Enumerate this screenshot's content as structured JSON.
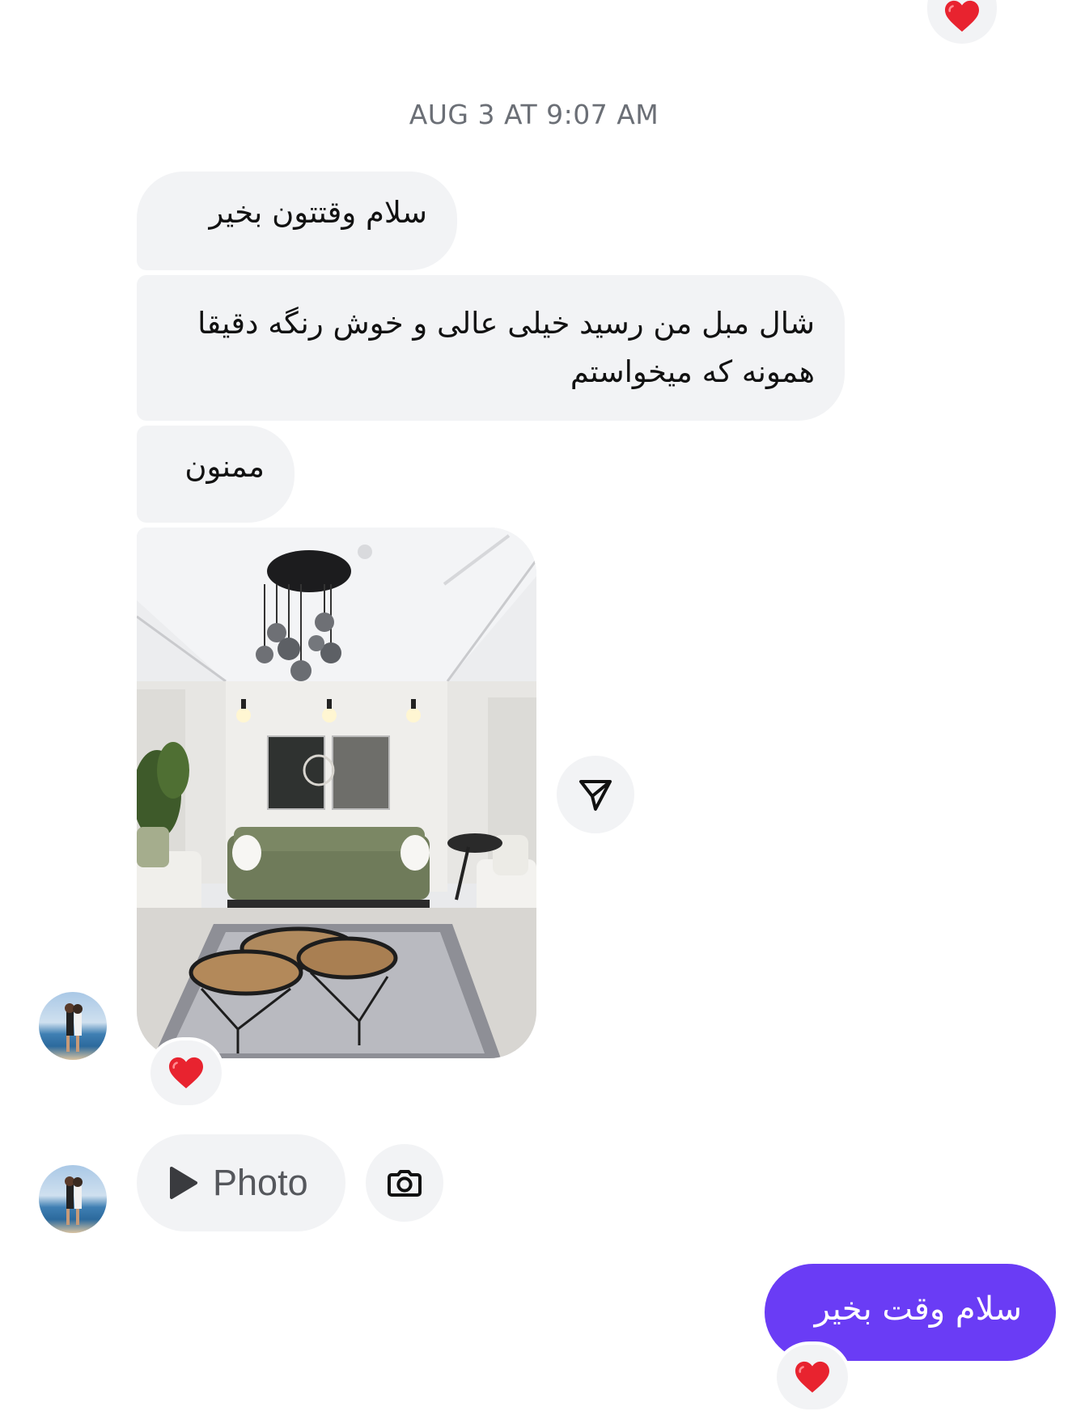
{
  "timestamp": "AUG 3 AT 9:07 AM",
  "incoming_messages": [
    {
      "text": "سلام وقتتون بخیر"
    },
    {
      "text": "شال مبل من رسید خیلی عالی و خوش رنگه دقیقا همونه که میخواستم"
    },
    {
      "text": "ممنون"
    }
  ],
  "photo_reply": {
    "label": "Photo"
  },
  "outgoing_message": {
    "text": "سلام وقت بخیر"
  },
  "colors": {
    "incoming_bubble": "#f2f3f5",
    "outgoing_bubble": "#6a3cf5",
    "reaction_heart": "#e8232f"
  },
  "icons": {
    "reaction": "heart-icon",
    "share": "paper-plane-icon",
    "play": "play-icon",
    "camera": "camera-icon"
  }
}
